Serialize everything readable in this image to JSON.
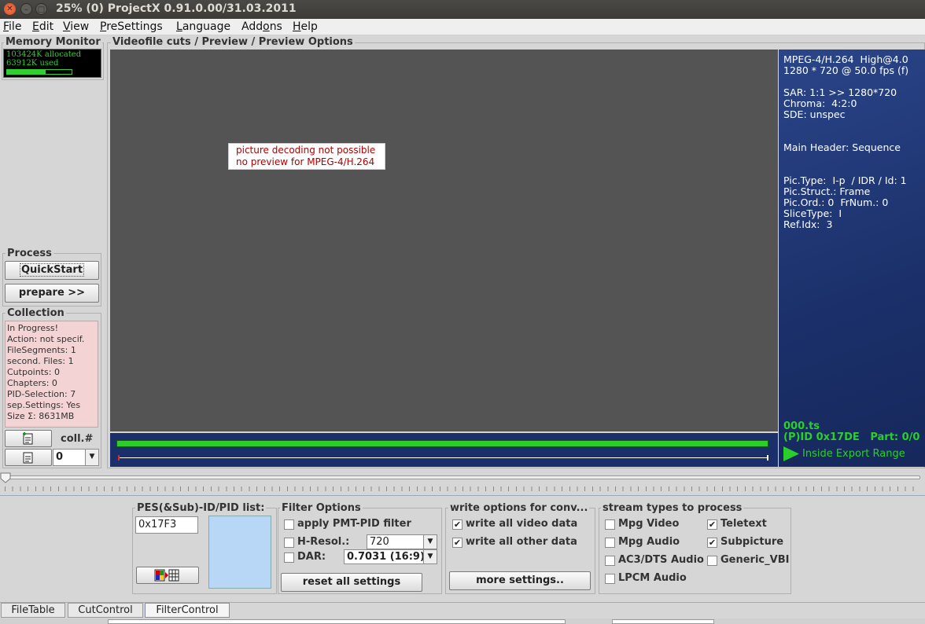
{
  "window": {
    "title": "25% (0) ProjectX 0.91.0.00/31.03.2011"
  },
  "menu": [
    {
      "label": "File",
      "u": "F",
      "rest": "ile"
    },
    {
      "label": "Edit",
      "u": "E",
      "rest": "dit"
    },
    {
      "label": "View",
      "u": "V",
      "rest": "iew"
    },
    {
      "label": "PreSettings",
      "u": "P",
      "rest": "reSettings"
    },
    {
      "label": "Language",
      "u": "L",
      "rest": "anguage"
    },
    {
      "label": "Addons",
      "pre": "Add",
      "u": "o",
      "rest": "ns"
    },
    {
      "label": "Help",
      "u": "H",
      "rest": "elp"
    }
  ],
  "memory": {
    "title": "Memory Monitor",
    "allocated": "103424K allocated",
    "used": "63912K used",
    "used_fraction": 0.6
  },
  "process": {
    "title": "Process",
    "quickstart": "QuickStart",
    "prepare": "prepare >>"
  },
  "collection": {
    "title": "Collection",
    "lines": [
      "In Progress!",
      "Action: not specif.",
      "FileSegments: 1",
      "second. Files: 1",
      "Cutpoints: 0",
      "Chapters: 0",
      "PID-Selection: 7",
      "sep.Settings: Yes",
      "Size Σ: 8631MB"
    ],
    "coll_label": "coll.#",
    "coll_value": "0"
  },
  "preview": {
    "title": "Videofile cuts / Preview / Preview Options",
    "message_line1": "picture decoding not possible",
    "message_line2": "no preview for MPEG-4/H.264"
  },
  "info": {
    "lines": [
      "MPEG-4/H.264  High@4.0",
      "1280 * 720 @ 50.0 fps (f)",
      "",
      "SAR: 1:1 >> 1280*720",
      "Chroma:  4:2:0",
      "SDE: unspec",
      "",
      "",
      "Main Header: Sequence",
      "",
      "",
      "Pic.Type:  I-p  / IDR / Id: 1",
      "Pic.Struct.: Frame",
      "Pic.Ord.: 0  FrNum.: 0",
      "SliceType:  I",
      "Ref.Idx:  3"
    ],
    "file": "000.ts",
    "pid": "(P)ID 0x17DE   Part: 0/0",
    "range": "Inside Export Range"
  },
  "filter": {
    "pes_title": "PES(&Sub)-ID/PID list:",
    "pes_value": "0x17F3",
    "options_title": "Filter Options",
    "apply_pmt": "apply PMT-PID filter",
    "hresol": "H-Resol.:",
    "hresol_value": "720",
    "dar": "DAR:",
    "dar_value": "0.7031 (16:9)",
    "reset": "reset all settings",
    "write_title": "write options for conv...",
    "write_video": "write all video data",
    "write_other": "write all other data",
    "more": "more settings..",
    "stream_title": "stream types to process",
    "mpg_video": "Mpg Video",
    "teletext": "Teletext",
    "mpg_audio": "Mpg Audio",
    "subpicture": "Subpicture",
    "ac3": "AC3/DTS Audio",
    "generic_vbi": "Generic_VBI",
    "lpcm": "LPCM Audio",
    "check_mark": "✔"
  },
  "tabs": [
    "FileTable",
    "CutControl",
    "FilterControl"
  ],
  "colors": {
    "preview_bg": "#545454",
    "info_bg": "#1c3470",
    "green": "#2ad02a",
    "error_red": "#b00000"
  }
}
